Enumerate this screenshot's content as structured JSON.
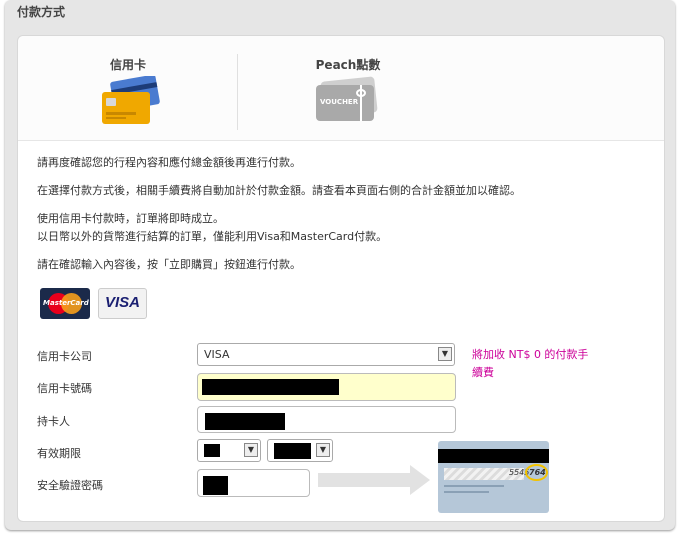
{
  "panel_title": "付款方式",
  "tabs": [
    {
      "label": "信用卡"
    },
    {
      "label": "Peach點數",
      "voucher_text": "VOUCHER"
    }
  ],
  "instructions": {
    "line1": "請再度確認您的行程內容和應付總金額後再進行付款。",
    "line2": "在選擇付款方式後，相關手續費將自動加計於付款金額。請查看本頁面右側的合計金額並加以確認。",
    "line3": "使用信用卡付款時，訂單將即時成立。",
    "line4": "以日幣以外的貨幣進行結算的訂單，僅能利用Visa和MasterCard付款。",
    "line5": "請在確認輸入內容後，按「立即購買」按鈕進行付款。"
  },
  "card_logos": {
    "mastercard": "MasterCard",
    "visa": "VISA"
  },
  "form": {
    "company_label": "信用卡公司",
    "company_value": "VISA",
    "number_label": "信用卡號碼",
    "holder_label": "持卡人",
    "expiry_label": "有效期限",
    "cvv_label": "安全驗證密碼"
  },
  "fee_note": "將加收 NT$ 0 的付款手續費",
  "cvv_image": {
    "digits": "5545",
    "cvv": "764"
  },
  "colors": {
    "fee_note": "#cc0099",
    "number_field_bg": "#ffffcc"
  }
}
